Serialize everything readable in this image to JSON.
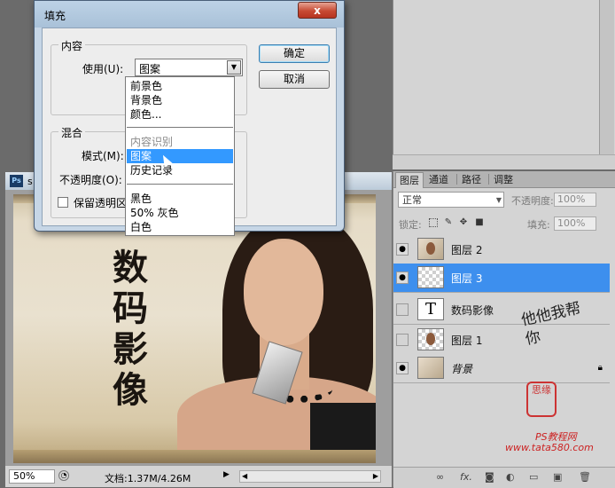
{
  "fill_dialog": {
    "title": "填充",
    "close_label": "x",
    "contents_group": "内容",
    "use_label": "使用(U):",
    "use_value": "图案",
    "blending_group": "混合",
    "mode_label": "模式(M):",
    "opacity_label": "不透明度(O):",
    "preserve_transparency": "保留透明区",
    "ok_label": "确定",
    "cancel_label": "取消"
  },
  "use_dropdown": {
    "items_a": [
      "前景色",
      "背景色",
      "颜色..."
    ],
    "items_b": [
      "内容识别",
      "图案",
      "历史记录"
    ],
    "items_c": [
      "黑色",
      "50% 灰色",
      "白色"
    ],
    "selected": "图案"
  },
  "document": {
    "title": "s",
    "ps_icon": "Ps",
    "zoom": "50%",
    "info": "文档:1.37M/4.26M",
    "canvas_text": [
      "数",
      "码",
      "影",
      "像"
    ]
  },
  "layers_panel": {
    "tabs": [
      "图层",
      "通道",
      "路径",
      "调整"
    ],
    "blend_mode": "正常",
    "opacity_label": "不透明度:",
    "opacity_value": "100%",
    "lock_label": "锁定:",
    "fill_label": "填充:",
    "fill_value": "100%",
    "layers": [
      {
        "name": "图层 2",
        "visible": true,
        "selected": false
      },
      {
        "name": "图层 3",
        "visible": true,
        "selected": true
      },
      {
        "name": "数码影像",
        "visible": false,
        "selected": false
      },
      {
        "name": "图层 1",
        "visible": false,
        "selected": false
      },
      {
        "name": "背景",
        "visible": true,
        "selected": false
      }
    ]
  },
  "watermark": {
    "chars": "他他我帮你",
    "seal": "思缘",
    "site_cn": "PS教程网",
    "site": "www.tata580.com"
  },
  "colors": {
    "selection": "#3399ff",
    "layer_selected": "#3d8fee",
    "close_button": "#c74a33"
  },
  "icons": {
    "eye": "eye-icon",
    "lock": "lock-icon",
    "link": "link-icon",
    "fx": "fx-icon",
    "trash": "trash-icon"
  }
}
